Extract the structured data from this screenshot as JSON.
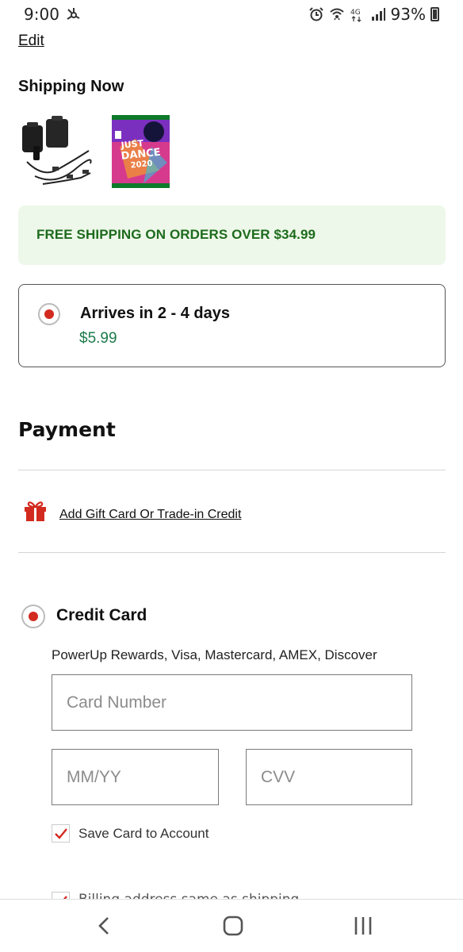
{
  "status_bar": {
    "time": "9:00",
    "battery": "93%",
    "icons": [
      "hub-icon",
      "alarm-icon",
      "wifi-icon",
      "4g-lte-icon",
      "signal-icon",
      "battery-icon"
    ]
  },
  "header": {
    "edit_label": "Edit"
  },
  "shipping": {
    "title": "Shipping Now",
    "items": [
      {
        "name": "controller-battery-pack-thumbnail"
      },
      {
        "name": "just-dance-2020-thumbnail",
        "cover_text": "JUST DANCE 2020"
      }
    ],
    "promo_text": "FREE SHIPPING ON ORDERS OVER $34.99",
    "option": {
      "title": "Arrives in 2 - 4 days",
      "price": "$5.99",
      "selected": true
    }
  },
  "payment": {
    "title": "Payment",
    "gift_card_link": "Add Gift Card Or Trade-in Credit",
    "credit_card": {
      "label": "Credit Card",
      "selected": true,
      "accepted": "PowerUp Rewards, Visa, Mastercard, AMEX, Discover",
      "card_number_placeholder": "Card Number",
      "expiry_placeholder": "MM/YY",
      "cvv_placeholder": "CVV",
      "save_card_label": "Save Card to Account",
      "save_card_checked": true,
      "billing_label": "Billing address same as shipping",
      "billing_checked": true
    }
  },
  "colors": {
    "accent_red": "#d32a1f",
    "promo_bg": "#eef8ea",
    "promo_text": "#1d6b1d",
    "price_green": "#1d7a4a"
  }
}
